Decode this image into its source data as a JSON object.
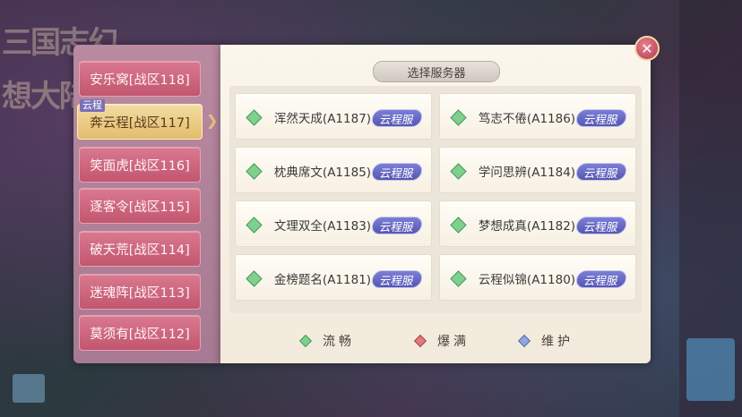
{
  "background": {
    "logo_text": "三国志幻想大陆"
  },
  "panel": {
    "title": "选择服务器"
  },
  "zones": [
    {
      "label": "安乐窝[战区118]",
      "active": false
    },
    {
      "label": "奔云程[战区117]",
      "active": true,
      "badge": "云程"
    },
    {
      "label": "笑面虎[战区116]",
      "active": false
    },
    {
      "label": "逐客令[战区115]",
      "active": false
    },
    {
      "label": "破天荒[战区114]",
      "active": false
    },
    {
      "label": "迷魂阵[战区113]",
      "active": false
    },
    {
      "label": "莫须有[战区112]",
      "active": false
    }
  ],
  "servers": [
    {
      "name": "浑然天成(A1187)",
      "tag": "云程服",
      "status": "流畅"
    },
    {
      "name": "笃志不倦(A1186)",
      "tag": "云程服",
      "status": "流畅"
    },
    {
      "name": "枕典席文(A1185)",
      "tag": "云程服",
      "status": "流畅"
    },
    {
      "name": "学问思辨(A1184)",
      "tag": "云程服",
      "status": "流畅"
    },
    {
      "name": "文理双全(A1183)",
      "tag": "云程服",
      "status": "流畅"
    },
    {
      "name": "梦想成真(A1182)",
      "tag": "云程服",
      "status": "流畅"
    },
    {
      "name": "金榜题名(A1181)",
      "tag": "云程服",
      "status": "流畅"
    },
    {
      "name": "云程似锦(A1180)",
      "tag": "云程服",
      "status": "流畅"
    }
  ],
  "legend": [
    {
      "label": "流畅",
      "color": "#7fd08e",
      "border": "#4a9a5c"
    },
    {
      "label": "爆满",
      "color": "#e27b7b",
      "border": "#a84545"
    },
    {
      "label": "维护",
      "color": "#8fa6e0",
      "border": "#5a6fa8"
    }
  ],
  "close": {
    "symbol": "✕"
  }
}
